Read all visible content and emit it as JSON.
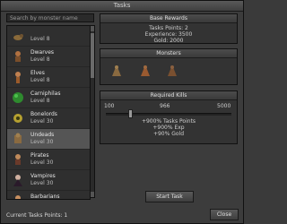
{
  "window": {
    "title": "Tasks"
  },
  "search": {
    "placeholder": "Search by monster name"
  },
  "monsters": [
    {
      "name": "",
      "level": "Level 8",
      "icon": "rat-icon"
    },
    {
      "name": "Dwarves",
      "level": "Level 8",
      "icon": "dwarf-icon"
    },
    {
      "name": "Elves",
      "level": "Level 8",
      "icon": "elf-icon"
    },
    {
      "name": "Carniphilas",
      "level": "Level 8",
      "icon": "carniphila-icon"
    },
    {
      "name": "Bonelords",
      "level": "Level 30",
      "icon": "bonelord-icon"
    },
    {
      "name": "Undeads",
      "level": "Level 30",
      "icon": "undead-icon",
      "selected": true
    },
    {
      "name": "Pirates",
      "level": "Level 30",
      "icon": "pirate-icon"
    },
    {
      "name": "Vampires",
      "level": "Level 30",
      "icon": "vampire-icon"
    },
    {
      "name": "Barbarians",
      "level": "",
      "icon": "barbarian-icon"
    }
  ],
  "base_rewards": {
    "title": "Base Rewards",
    "task_points": "Tasks Points: 2",
    "experience": "Experience: 3500",
    "gold": "Gold: 2000"
  },
  "monsters_panel": {
    "title": "Monsters",
    "icons": [
      "undead-icon-1",
      "undead-icon-2",
      "undead-icon-3"
    ]
  },
  "required_kills": {
    "title": "Required Kills",
    "min": "100",
    "mid": "966",
    "max": "5000",
    "value_fraction": 0.18
  },
  "bonus": {
    "points": "+900% Tasks Points",
    "exp": "+900% Exp",
    "gold": "+90% Gold"
  },
  "buttons": {
    "start": "Start Task",
    "close": "Close"
  },
  "footer": {
    "current_points": "Current Tasks Points: 1"
  },
  "colors": {
    "selected_bg": "#555555",
    "panel_bg": "#333333"
  }
}
